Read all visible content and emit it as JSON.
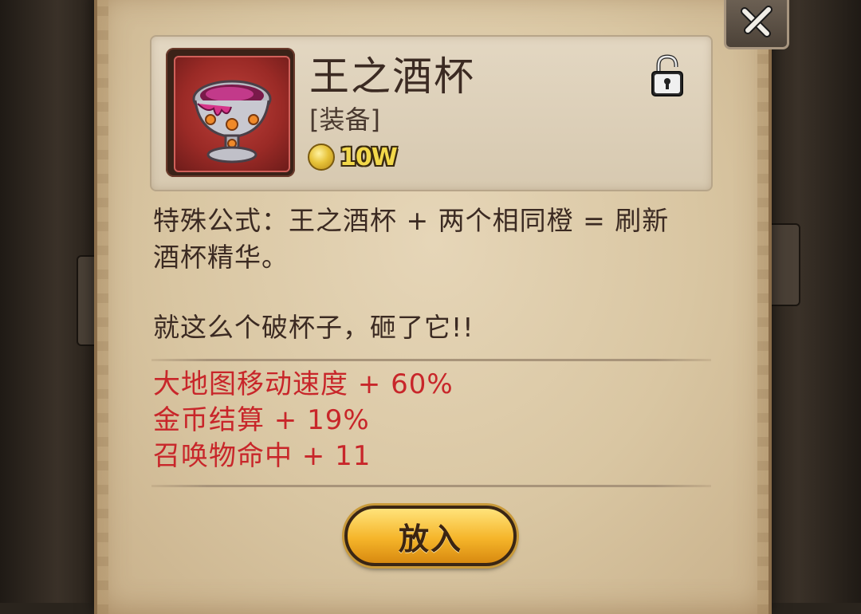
{
  "item": {
    "name": "王之酒杯",
    "type": "[装备]",
    "price": "10W",
    "icon": "chalice-icon"
  },
  "description": {
    "formula_line1": "特殊公式：王之酒杯 + 两个相同橙 = 刷新",
    "formula_line2": "酒杯精华。",
    "flavor": "就这么个破杯子，砸了它!!"
  },
  "stats": [
    "大地图移动速度 + 60%",
    "金币结算 + 19%",
    "召唤物命中 + 11"
  ],
  "buttons": {
    "put_in": "放入"
  },
  "colors": {
    "stat_red": "#c8262a",
    "text_dark": "#3b2a22",
    "gold": "#f2d84a"
  }
}
